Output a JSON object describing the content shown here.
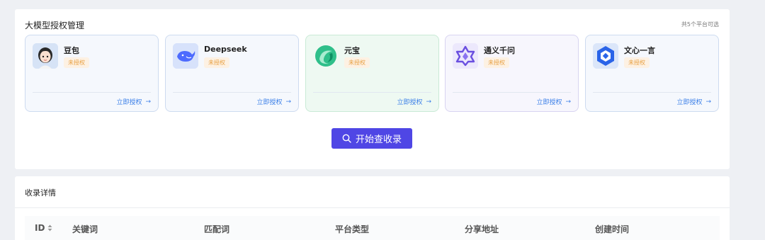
{
  "auth_panel": {
    "title": "大模型授权管理",
    "platform_count": "共5个平台可选",
    "cards": [
      {
        "name": "豆包",
        "status": "未授权",
        "action": "立即授权",
        "icon": "doubao-avatar-icon"
      },
      {
        "name": "Deepseek",
        "status": "未授权",
        "action": "立即授权",
        "icon": "deepseek-whale-icon"
      },
      {
        "name": "元宝",
        "status": "未授权",
        "action": "立即授权",
        "icon": "yuanbao-icon"
      },
      {
        "name": "通义千问",
        "status": "未授权",
        "action": "立即授权",
        "icon": "tongyi-icon"
      },
      {
        "name": "文心一言",
        "status": "未授权",
        "action": "立即授权",
        "icon": "wenxin-icon"
      }
    ],
    "start_button": "开始查收录"
  },
  "records_panel": {
    "title": "收录详情",
    "columns": [
      "ID",
      "关键词",
      "匹配词",
      "平台类型",
      "分享地址",
      "创建时间"
    ]
  },
  "colors": {
    "primary": "#4f46e5",
    "link": "#3b7fe8",
    "badge_text": "#e8a042",
    "badge_bg": "#fdf1e3"
  }
}
